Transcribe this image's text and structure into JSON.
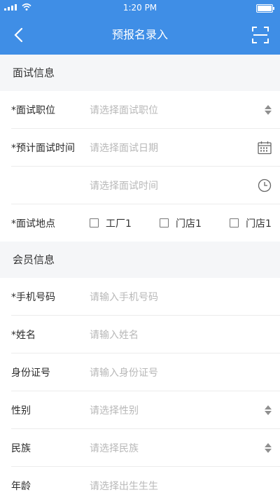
{
  "status": {
    "time": "1:20 PM"
  },
  "header": {
    "title": "预报名录入",
    "back_icon": "chevron-left-icon",
    "scan_icon": "scan-icon"
  },
  "interview": {
    "section_title": "面试信息",
    "position": {
      "label": "*面试职位",
      "placeholder": "请选择面试职位"
    },
    "date": {
      "label": "*预计面试时间",
      "placeholder": "请选择面试日期"
    },
    "time": {
      "placeholder": "请选择面试时间"
    },
    "location": {
      "label": "*面试地点",
      "options": [
        "工厂1",
        "门店1",
        "门店1"
      ]
    }
  },
  "member": {
    "section_title": "会员信息",
    "phone": {
      "label": "*手机号码",
      "placeholder": "请输入手机号码"
    },
    "name": {
      "label": "*姓名",
      "placeholder": "请输入姓名"
    },
    "idcard": {
      "label": "身份证号",
      "placeholder": "请输入身份证号"
    },
    "gender": {
      "label": "性别",
      "placeholder": "请选择性别"
    },
    "ethnicity": {
      "label": "民族",
      "placeholder": "请选择民族"
    },
    "age": {
      "label": "年龄",
      "placeholder": "请选择出生生生"
    }
  },
  "colors": {
    "primary": "#3f8ee6",
    "placeholder": "#b8b8b8",
    "background": "#f5f6f8"
  }
}
